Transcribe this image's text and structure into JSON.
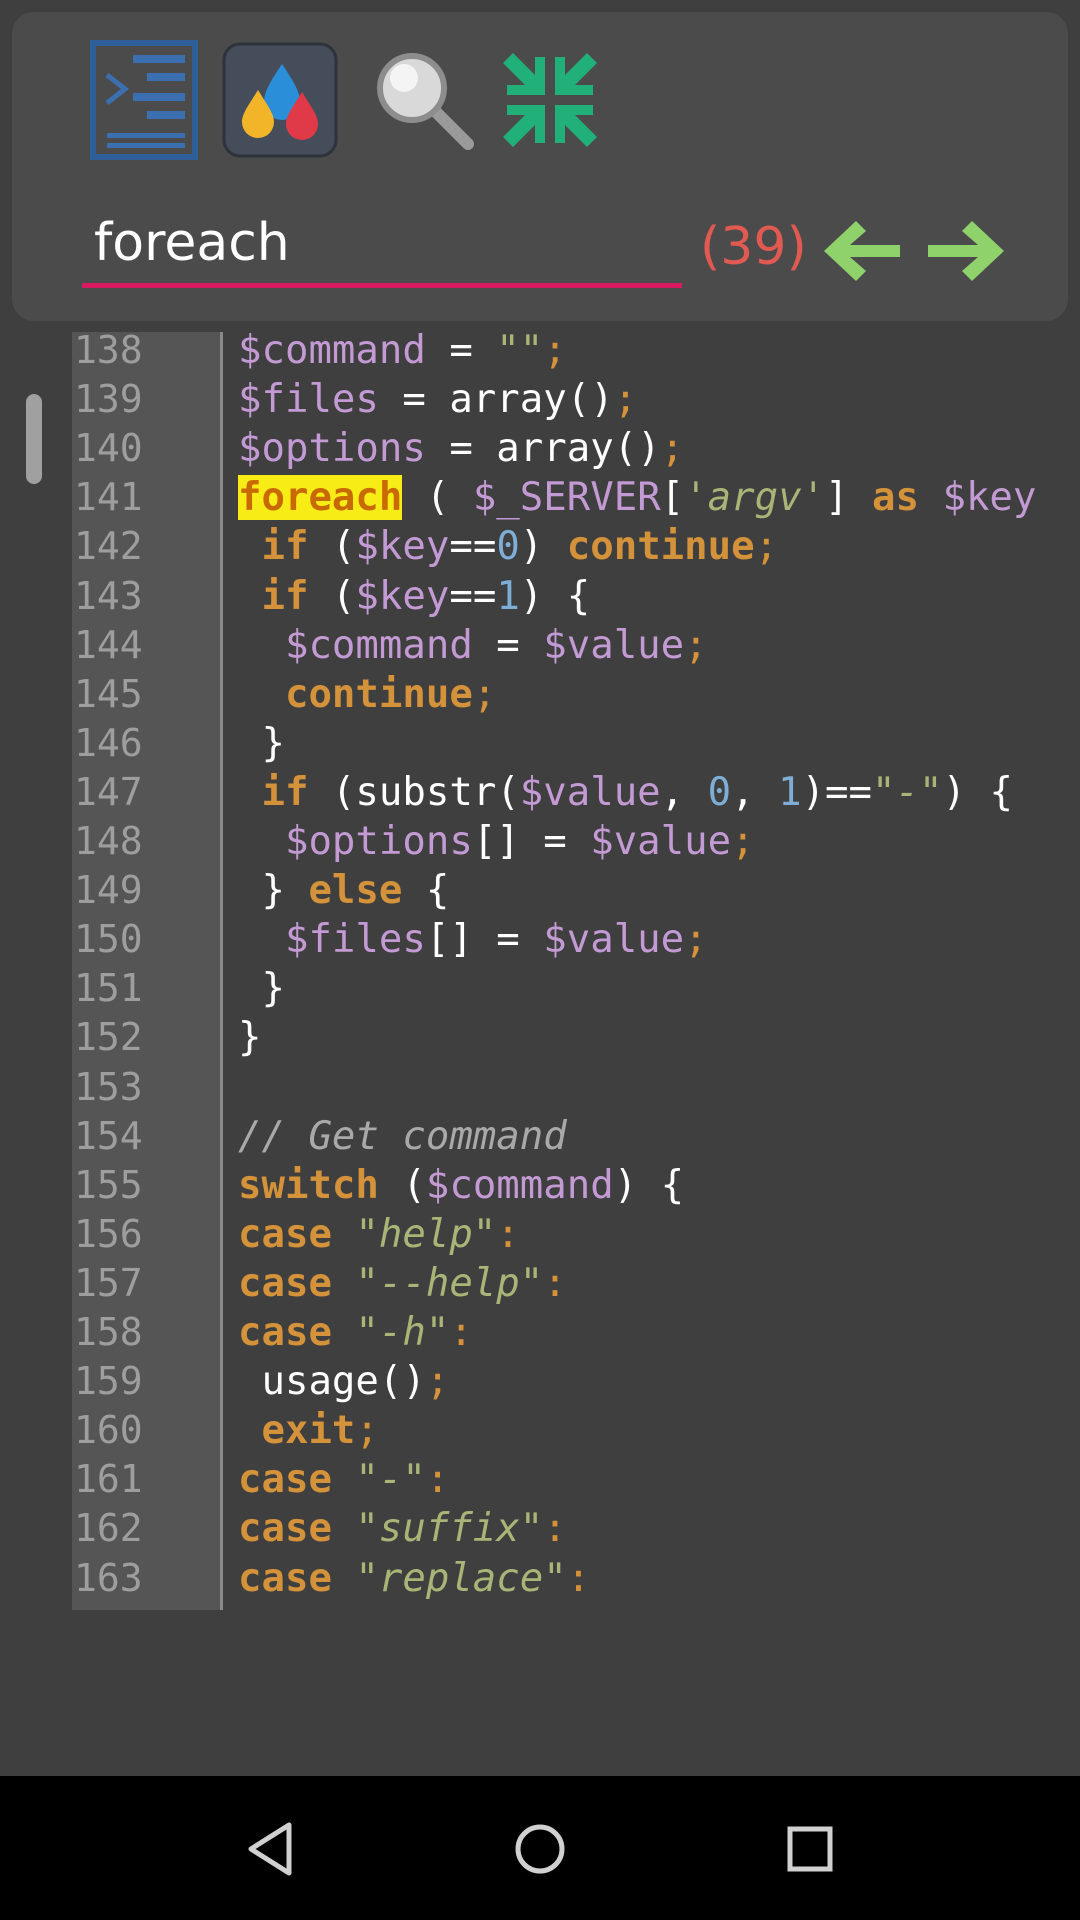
{
  "toolbar": {
    "buttons": [
      {
        "name": "console-icon"
      },
      {
        "name": "color-palette-icon"
      },
      {
        "name": "magnifier-icon"
      },
      {
        "name": "collapse-icon"
      }
    ]
  },
  "search": {
    "query": "foreach",
    "match_count": "(39)",
    "accent_color": "#d81b60",
    "prev_icon": "arrow-left-icon",
    "next_icon": "arrow-right-icon"
  },
  "editor": {
    "lines": [
      {
        "n": "138",
        "tokens": [
          {
            "t": "$command",
            "c": "var"
          },
          {
            "t": " = ",
            "c": "pl"
          },
          {
            "t": "\"\"",
            "c": "str"
          },
          {
            "t": ";",
            "c": "punc"
          }
        ]
      },
      {
        "n": "139",
        "tokens": [
          {
            "t": "$files",
            "c": "var"
          },
          {
            "t": " = array()",
            "c": "pl"
          },
          {
            "t": ";",
            "c": "punc"
          }
        ]
      },
      {
        "n": "140",
        "tokens": [
          {
            "t": "$options",
            "c": "var"
          },
          {
            "t": " = array()",
            "c": "pl"
          },
          {
            "t": ";",
            "c": "punc"
          }
        ]
      },
      {
        "n": "141",
        "tokens": [
          {
            "t": "foreach",
            "c": "hl"
          },
          {
            "t": " ( ",
            "c": "pl"
          },
          {
            "t": "$_SERVER",
            "c": "var"
          },
          {
            "t": "[",
            "c": "pl"
          },
          {
            "t": "'argv'",
            "c": "str"
          },
          {
            "t": "] ",
            "c": "pl"
          },
          {
            "t": "as",
            "c": "kw"
          },
          {
            "t": " ",
            "c": "pl"
          },
          {
            "t": "$key",
            "c": "var"
          }
        ]
      },
      {
        "n": "142",
        "tokens": [
          {
            "t": " ",
            "c": "pl"
          },
          {
            "t": "if",
            "c": "kw"
          },
          {
            "t": " (",
            "c": "pl"
          },
          {
            "t": "$key",
            "c": "var"
          },
          {
            "t": "==",
            "c": "pl"
          },
          {
            "t": "0",
            "c": "num"
          },
          {
            "t": ") ",
            "c": "pl"
          },
          {
            "t": "continue",
            "c": "kw"
          },
          {
            "t": ";",
            "c": "punc"
          }
        ]
      },
      {
        "n": "143",
        "tokens": [
          {
            "t": " ",
            "c": "pl"
          },
          {
            "t": "if",
            "c": "kw"
          },
          {
            "t": " (",
            "c": "pl"
          },
          {
            "t": "$key",
            "c": "var"
          },
          {
            "t": "==",
            "c": "pl"
          },
          {
            "t": "1",
            "c": "num"
          },
          {
            "t": ") {",
            "c": "pl"
          }
        ]
      },
      {
        "n": "144",
        "tokens": [
          {
            "t": "  ",
            "c": "pl"
          },
          {
            "t": "$command",
            "c": "var"
          },
          {
            "t": " = ",
            "c": "pl"
          },
          {
            "t": "$value",
            "c": "var"
          },
          {
            "t": ";",
            "c": "punc"
          }
        ]
      },
      {
        "n": "145",
        "tokens": [
          {
            "t": "  ",
            "c": "pl"
          },
          {
            "t": "continue",
            "c": "kw"
          },
          {
            "t": ";",
            "c": "punc"
          }
        ]
      },
      {
        "n": "146",
        "tokens": [
          {
            "t": " }",
            "c": "pl"
          }
        ]
      },
      {
        "n": "147",
        "tokens": [
          {
            "t": " ",
            "c": "pl"
          },
          {
            "t": "if",
            "c": "kw"
          },
          {
            "t": " (substr(",
            "c": "pl"
          },
          {
            "t": "$value",
            "c": "var"
          },
          {
            "t": ", ",
            "c": "pl"
          },
          {
            "t": "0",
            "c": "num"
          },
          {
            "t": ", ",
            "c": "pl"
          },
          {
            "t": "1",
            "c": "num"
          },
          {
            "t": ")==",
            "c": "pl"
          },
          {
            "t": "\"-\"",
            "c": "str"
          },
          {
            "t": ") {",
            "c": "pl"
          }
        ]
      },
      {
        "n": "148",
        "tokens": [
          {
            "t": "  ",
            "c": "pl"
          },
          {
            "t": "$options",
            "c": "var"
          },
          {
            "t": "[] = ",
            "c": "pl"
          },
          {
            "t": "$value",
            "c": "var"
          },
          {
            "t": ";",
            "c": "punc"
          }
        ]
      },
      {
        "n": "149",
        "tokens": [
          {
            "t": " } ",
            "c": "pl"
          },
          {
            "t": "else",
            "c": "kw"
          },
          {
            "t": " {",
            "c": "pl"
          }
        ]
      },
      {
        "n": "150",
        "tokens": [
          {
            "t": "  ",
            "c": "pl"
          },
          {
            "t": "$files",
            "c": "var"
          },
          {
            "t": "[] = ",
            "c": "pl"
          },
          {
            "t": "$value",
            "c": "var"
          },
          {
            "t": ";",
            "c": "punc"
          }
        ]
      },
      {
        "n": "151",
        "tokens": [
          {
            "t": " }",
            "c": "pl"
          }
        ]
      },
      {
        "n": "152",
        "tokens": [
          {
            "t": "}",
            "c": "pl"
          }
        ]
      },
      {
        "n": "153",
        "tokens": []
      },
      {
        "n": "154",
        "tokens": [
          {
            "t": "// Get command",
            "c": "cmt"
          }
        ]
      },
      {
        "n": "155",
        "tokens": [
          {
            "t": "switch",
            "c": "kw"
          },
          {
            "t": " (",
            "c": "pl"
          },
          {
            "t": "$command",
            "c": "var"
          },
          {
            "t": ") {",
            "c": "pl"
          }
        ]
      },
      {
        "n": "156",
        "tokens": [
          {
            "t": "case",
            "c": "kw"
          },
          {
            "t": " ",
            "c": "pl"
          },
          {
            "t": "\"help\"",
            "c": "str"
          },
          {
            "t": ":",
            "c": "punc"
          }
        ]
      },
      {
        "n": "157",
        "tokens": [
          {
            "t": "case",
            "c": "kw"
          },
          {
            "t": " ",
            "c": "pl"
          },
          {
            "t": "\"--help\"",
            "c": "str"
          },
          {
            "t": ":",
            "c": "punc"
          }
        ]
      },
      {
        "n": "158",
        "tokens": [
          {
            "t": "case",
            "c": "kw"
          },
          {
            "t": " ",
            "c": "pl"
          },
          {
            "t": "\"-h\"",
            "c": "str"
          },
          {
            "t": ":",
            "c": "punc"
          }
        ]
      },
      {
        "n": "159",
        "tokens": [
          {
            "t": " usage()",
            "c": "pl"
          },
          {
            "t": ";",
            "c": "punc"
          }
        ]
      },
      {
        "n": "160",
        "tokens": [
          {
            "t": " ",
            "c": "pl"
          },
          {
            "t": "exit",
            "c": "kw"
          },
          {
            "t": ";",
            "c": "punc"
          }
        ]
      },
      {
        "n": "161",
        "tokens": [
          {
            "t": "case",
            "c": "kw"
          },
          {
            "t": " ",
            "c": "pl"
          },
          {
            "t": "\"-\"",
            "c": "str"
          },
          {
            "t": ":",
            "c": "punc"
          }
        ]
      },
      {
        "n": "162",
        "tokens": [
          {
            "t": "case",
            "c": "kw"
          },
          {
            "t": " ",
            "c": "pl"
          },
          {
            "t": "\"suffix\"",
            "c": "str"
          },
          {
            "t": ":",
            "c": "punc"
          }
        ]
      },
      {
        "n": "163",
        "tokens": [
          {
            "t": "case",
            "c": "kw"
          },
          {
            "t": " ",
            "c": "pl"
          },
          {
            "t": "\"replace\"",
            "c": "str"
          },
          {
            "t": ":",
            "c": "punc"
          }
        ]
      }
    ]
  },
  "system_nav": {
    "back": "back-icon",
    "home": "home-icon",
    "recents": "recents-icon"
  }
}
